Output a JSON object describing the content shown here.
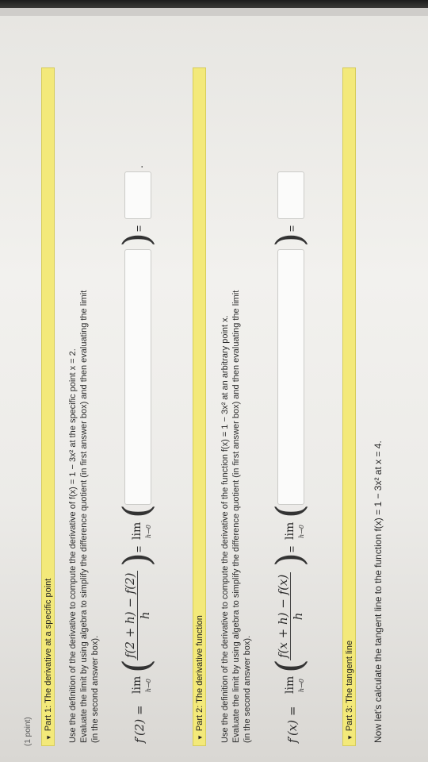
{
  "point_label": "(1 point)",
  "parts": [
    {
      "header": "Part 1: The derivative at a specific point",
      "text_lines": [
        "Use the definition of the derivative to compute the derivative of f(x) = 1 − 3x² at the specific point x = 2.",
        "Evaluate the limit by using algebra to simplify the difference quotient (in first answer box) and then evaluating the limit",
        "(in the second answer box)."
      ],
      "lhs": "f′(2) =",
      "lim": "lim",
      "lim_sub": "h→0",
      "numerator": "f(2 + h) − f(2)",
      "denominator": "h",
      "equals": "=",
      "lim2": "lim",
      "lim2_sub": "h→0",
      "paren_close_eq": "=",
      "tail": "."
    },
    {
      "header": "Part 2: The derivative function",
      "text_lines": [
        "Use the definition of the derivative to compute the derivative of the function f(x) = 1 − 3x² at an arbitrary point x.",
        "Evaluate the limit by using algebra to simplify the difference quotient (in first answer box) and then evaluating the limit",
        "(in the second answer box)."
      ],
      "lhs": "f′(x) =",
      "lim": "lim",
      "lim_sub": "h→0",
      "numerator": "f(x + h) − f(x)",
      "denominator": "h",
      "equals": "=",
      "lim2": "lim",
      "lim2_sub": "h→0",
      "paren_close_eq": "="
    },
    {
      "header": "Part 3: The tangent line",
      "text_lines": [
        "Now let's calculate the tangent line to the function f(x) = 1 − 3x² at x = 4."
      ]
    }
  ]
}
